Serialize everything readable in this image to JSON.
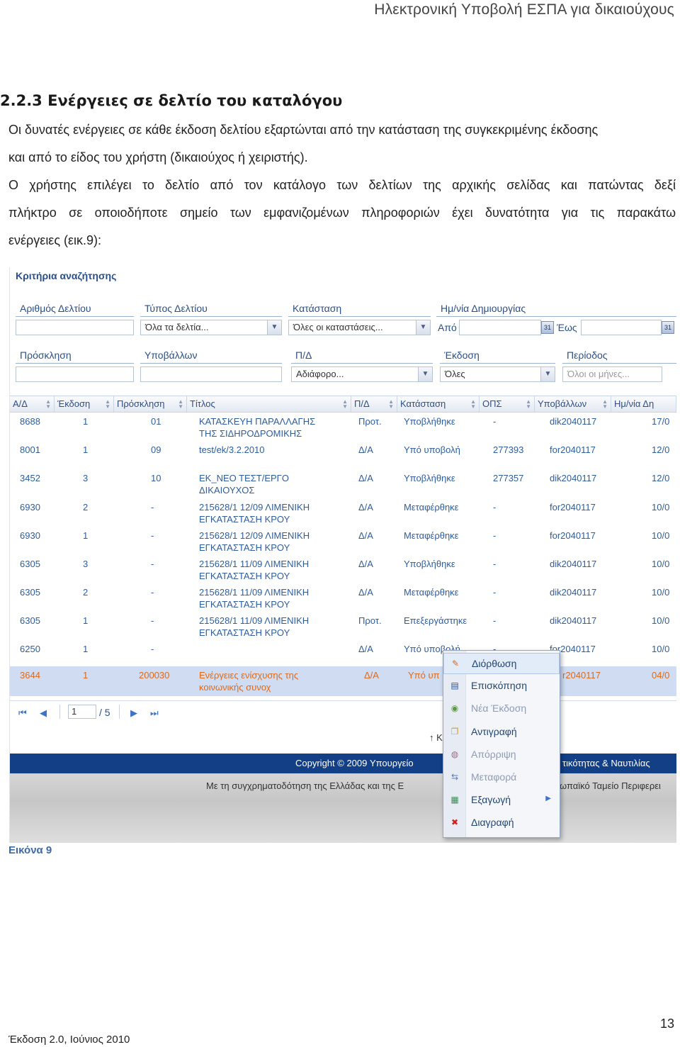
{
  "header": {
    "running_title": "Ηλεκτρονική Υποβολή ΕΣΠΑ για δικαιούχους"
  },
  "section": {
    "heading": "2.2.3 Ενέργειες σε δελτίο του καταλόγου",
    "para1_line1": "Οι δυνατές ενέργειες σε κάθε έκδοση δελτίου εξαρτώνται από την κατάσταση της συγκεκριμένης έκδοσης",
    "para1_line2": "και από το είδος του χρήστη (δικαιούχος ή χειριστής).",
    "para2_line1": "Ο χρήστης επιλέγει το δελτίο από τον κατάλογο των δελτίων της αρχικής σελίδας και πατώντας δεξί",
    "para2_line2": "πλήκτρο σε οποιοδήποτε σημείο των εμφανιζομένων πληροφοριών έχει δυνατότητα για τις παρακάτω",
    "para2_line3": "ενέργειες (εικ.9):"
  },
  "search": {
    "title": "Κριτήρια αναζήτησης",
    "f_number": "Αριθμός Δελτίου",
    "f_type": "Τύπος Δελτίου",
    "f_type_value": "Όλα τα δελτία...",
    "f_status": "Κατάσταση",
    "f_status_value": "Όλες οι καταστάσεις...",
    "f_date": "Ημ/νία Δημιουργίας",
    "f_from": "Από",
    "f_to": "Έως",
    "f_call": "Πρόσκληση",
    "f_submitter": "Υποβάλλων",
    "f_pd": "Π/Δ",
    "f_pd_value": "Αδιάφορο...",
    "f_edition": "Έκδοση",
    "f_edition_value": "Όλες",
    "f_period": "Περίοδος",
    "f_period_value": "Όλοι οι μήνες..."
  },
  "grid": {
    "columns": [
      "Α/Δ",
      "Έκδοση",
      "Πρόσκληση",
      "Τίτλος",
      "Π/Δ",
      "Κατάσταση",
      "ΟΠΣ",
      "Υποβάλλων",
      "Ημ/νία Δη"
    ],
    "rows": [
      {
        "ad": "8688",
        "ek": "1",
        "pr": "01",
        "t1": "ΚΑΤΑΣΚΕΥΗ ΠΑΡΑΛΛΑΓΗΣ",
        "t2": "ΤΗΣ ΣΙΔΗΡΟΔΡΟΜΙΚΗΣ",
        "pd": "Προτ.",
        "st": "Υποβλήθηκε",
        "ops": "-",
        "sub": "dik2040117",
        "dt": "17/0"
      },
      {
        "ad": "8001",
        "ek": "1",
        "pr": "09",
        "t1": "test/ek/3.2.2010",
        "t2": "",
        "pd": "Δ/Α",
        "st": "Υπό υποβολή",
        "ops": "277393",
        "sub": "for2040117",
        "dt": "12/0"
      },
      {
        "ad": "3452",
        "ek": "3",
        "pr": "10",
        "t1": "ΕΚ_ΝΕΟ ΤΕΣΤ/ΕΡΓΟ",
        "t2": "ΔΙΚΑΙΟΥΧΟΣ",
        "pd": "Δ/Α",
        "st": "Υποβλήθηκε",
        "ops": "277357",
        "sub": "dik2040117",
        "dt": "12/0"
      },
      {
        "ad": "6930",
        "ek": "2",
        "pr": "-",
        "t1": "215628/1 12/09 ΛΙΜΕΝΙΚΗ",
        "t2": "ΕΓΚΑΤΑΣΤΑΣΗ ΚΡΟΥ",
        "pd": "Δ/Α",
        "st": "Μεταφέρθηκε",
        "ops": "-",
        "sub": "for2040117",
        "dt": "10/0"
      },
      {
        "ad": "6930",
        "ek": "1",
        "pr": "-",
        "t1": "215628/1 12/09 ΛΙΜΕΝΙΚΗ",
        "t2": "ΕΓΚΑΤΑΣΤΑΣΗ ΚΡΟΥ",
        "pd": "Δ/Α",
        "st": "Μεταφέρθηκε",
        "ops": "-",
        "sub": "for2040117",
        "dt": "10/0"
      },
      {
        "ad": "6305",
        "ek": "3",
        "pr": "-",
        "t1": "215628/1 11/09 ΛΙΜΕΝΙΚΗ",
        "t2": "ΕΓΚΑΤΑΣΤΑΣΗ ΚΡΟΥ",
        "pd": "Δ/Α",
        "st": "Υποβλήθηκε",
        "ops": "-",
        "sub": "dik2040117",
        "dt": "10/0"
      },
      {
        "ad": "6305",
        "ek": "2",
        "pr": "-",
        "t1": "215628/1 11/09 ΛΙΜΕΝΙΚΗ",
        "t2": "ΕΓΚΑΤΑΣΤΑΣΗ ΚΡΟΥ",
        "pd": "Δ/Α",
        "st": "Μεταφέρθηκε",
        "ops": "-",
        "sub": "dik2040117",
        "dt": "10/0"
      },
      {
        "ad": "6305",
        "ek": "1",
        "pr": "-",
        "t1": "215628/1 11/09 ΛΙΜΕΝΙΚΗ",
        "t2": "ΕΓΚΑΤΑΣΤΑΣΗ ΚΡΟΥ",
        "pd": "Προτ.",
        "st": "Επεξεργάστηκε",
        "ops": "-",
        "sub": "dik2040117",
        "dt": "10/0"
      },
      {
        "ad": "6250",
        "ek": "1",
        "pr": "-",
        "t1": "",
        "t2": "",
        "pd": "Δ/Α",
        "st": "Υπό υποβολή",
        "ops": "-",
        "sub": "for2040117",
        "dt": "10/0"
      }
    ],
    "selected": {
      "ad": "3644",
      "ek": "1",
      "pr": "200030",
      "t1": "Ενέργειες ενίσχυσης της",
      "t2": "κοινωνικής συνοχ",
      "pd": "Δ/Α",
      "st": "Υπό υπ",
      "sub": "r2040117",
      "dt": "04/0"
    }
  },
  "pager": {
    "current": "1",
    "total": "/ 5"
  },
  "footer": {
    "copyright_left": "Copyright © 2009 Υπουργείο",
    "copyright_right": "τικότητας & Ναυτιλίας",
    "cofund_left": "Με τη συγχρηματοδότηση της Ελλάδας και της Ε",
    "cofund_right": "ωπαϊκό Ταμείο Περιφερει",
    "partial": "↑ Κ"
  },
  "context_menu": {
    "items": [
      {
        "label": "Διόρθωση",
        "icon": "edit-icon",
        "enabled": true
      },
      {
        "label": "Επισκόπηση",
        "icon": "preview-icon",
        "enabled": true
      },
      {
        "label": "Νέα Έκδοση",
        "icon": "new-version-icon",
        "enabled": false
      },
      {
        "label": "Αντιγραφή",
        "icon": "copy-icon",
        "enabled": true
      },
      {
        "label": "Απόρριψη",
        "icon": "reject-icon",
        "enabled": false
      },
      {
        "label": "Μεταφορά",
        "icon": "transfer-icon",
        "enabled": false
      },
      {
        "label": "Εξαγωγή",
        "icon": "export-icon",
        "enabled": true
      },
      {
        "label": "Διαγραφή",
        "icon": "delete-icon",
        "enabled": true
      }
    ]
  },
  "caption": "Εικόνα 9",
  "page_number": "13",
  "version_line": "Έκδοση 2.0, Ιούνιος 2010"
}
